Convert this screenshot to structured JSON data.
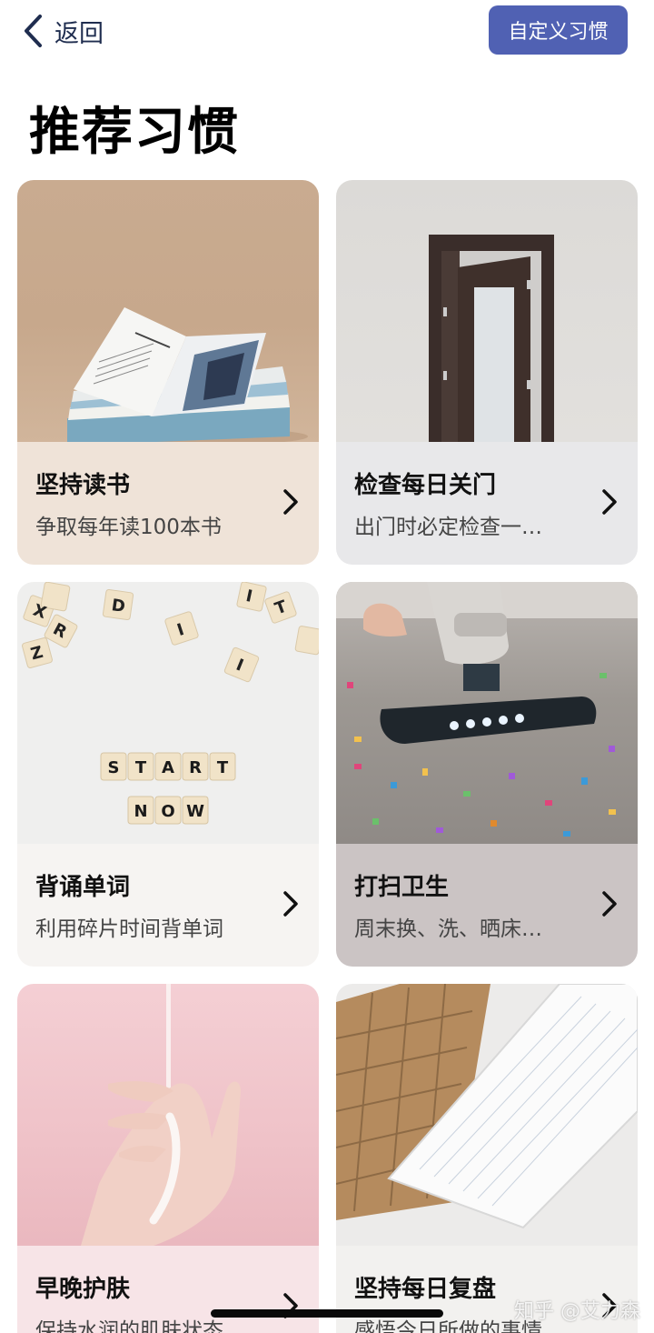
{
  "header": {
    "back_label": "返回",
    "custom_button_label": "自定义习惯"
  },
  "page_title": "推荐习惯",
  "cards": [
    {
      "title": "坚持读书",
      "subtitle": "争取每年读100本书"
    },
    {
      "title": "检查每日关门",
      "subtitle": "出门时必定检查一…"
    },
    {
      "title": "背诵单词",
      "subtitle": "利用碎片时间背单词"
    },
    {
      "title": "打扫卫生",
      "subtitle": "周末换、洗、晒床…"
    },
    {
      "title": "早晚护肤",
      "subtitle": "保持水润的肌肤状态"
    },
    {
      "title": "坚持每日复盘",
      "subtitle": "感悟今日所做的事情"
    }
  ],
  "scrabble": {
    "start": [
      "S",
      "T",
      "A",
      "R",
      "T"
    ],
    "now": [
      "N",
      "O",
      "W"
    ]
  },
  "watermark": "知乎 @艾力森",
  "colors": {
    "accent": "#5061b3",
    "back_arrow": "#1f2d4f"
  }
}
